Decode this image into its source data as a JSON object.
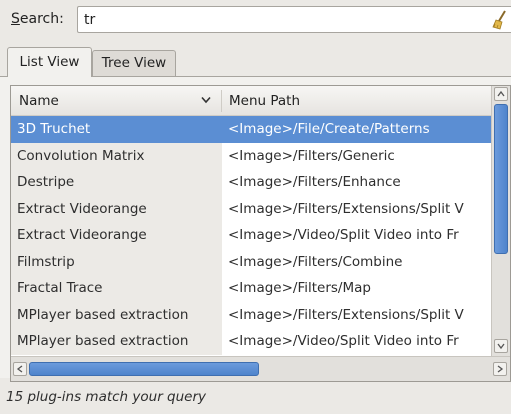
{
  "search": {
    "label_mnemonic": "S",
    "label_rest": "earch:",
    "value": "tr",
    "clear_icon": "broom-clear-icon"
  },
  "tabs": [
    {
      "label": "List View",
      "active": true
    },
    {
      "label": "Tree View",
      "active": false
    }
  ],
  "table": {
    "columns": [
      "Name",
      "Menu Path"
    ],
    "sort_icon": "chevron-down-icon",
    "rows": [
      {
        "name": "3D Truchet",
        "path": "<Image>/File/Create/Patterns",
        "selected": true
      },
      {
        "name": "Convolution Matrix",
        "path": "<Image>/Filters/Generic"
      },
      {
        "name": "Destripe",
        "path": "<Image>/Filters/Enhance"
      },
      {
        "name": "Extract Videorange",
        "path": "<Image>/Filters/Extensions/Split V"
      },
      {
        "name": "Extract Videorange",
        "path": "<Image>/Video/Split Video into Fr"
      },
      {
        "name": "Filmstrip",
        "path": "<Image>/Filters/Combine"
      },
      {
        "name": "Fractal Trace",
        "path": "<Image>/Filters/Map"
      },
      {
        "name": "MPlayer based extraction",
        "path": "<Image>/Filters/Extensions/Split V"
      },
      {
        "name": "MPlayer based extraction",
        "path": "<Image>/Video/Split Video into Fr"
      }
    ]
  },
  "status": "15 plug-ins match your query",
  "colors": {
    "selection": "#5b8ed3",
    "background": "#ebe9e5"
  }
}
